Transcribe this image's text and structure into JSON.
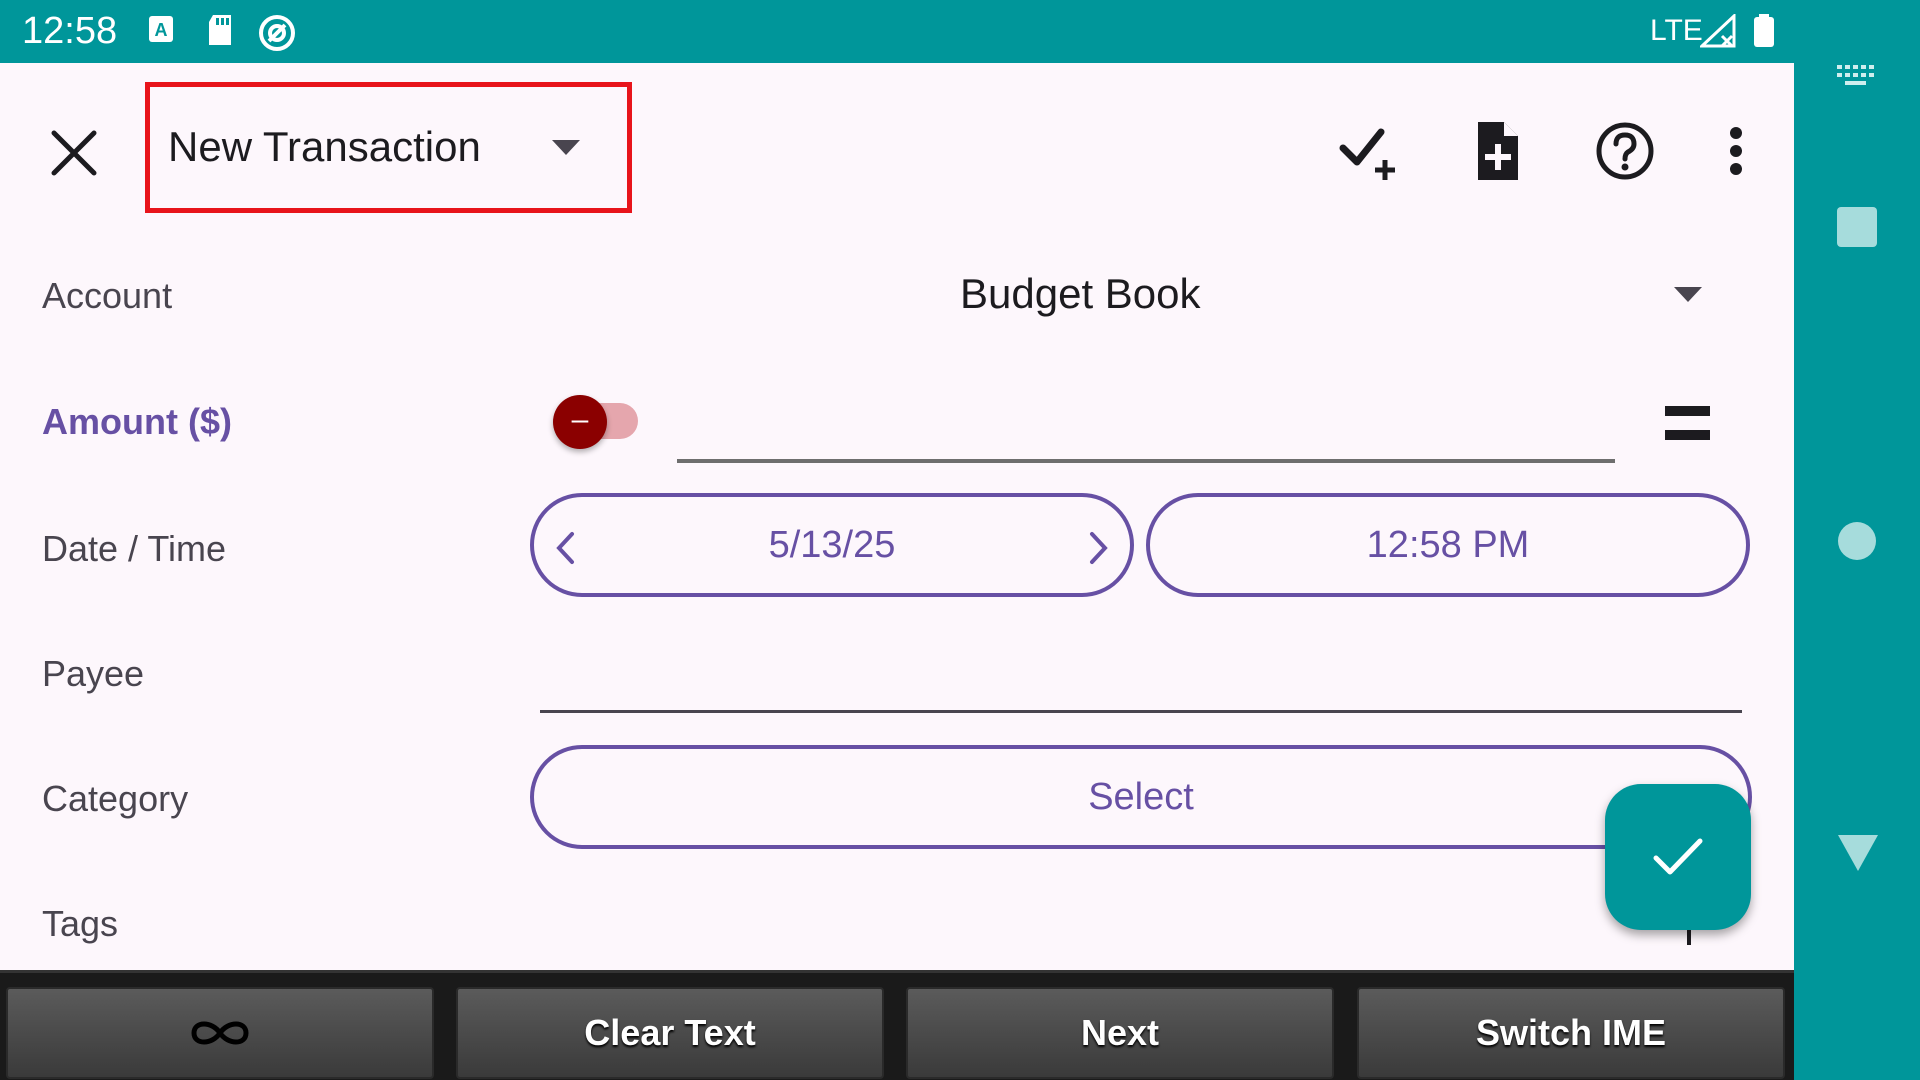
{
  "status_bar": {
    "time": "12:58",
    "network": "LTE",
    "icons": [
      "a-notification-icon",
      "sd-card-icon",
      "sync-icon",
      "signal-icon",
      "battery-icon"
    ]
  },
  "toolbar": {
    "title": "New Transaction",
    "icons": [
      "close-icon",
      "dropdown-caret-icon",
      "save-and-new-icon",
      "add-document-icon",
      "help-icon",
      "more-vert-icon"
    ]
  },
  "form": {
    "account_label": "Account",
    "account_value": "Budget Book",
    "amount_label": "Amount ($)",
    "amount_value": "",
    "amount_sign": "–",
    "datetime_label": "Date / Time",
    "date_value": "5/13/25",
    "time_value": "12:58 PM",
    "payee_label": "Payee",
    "payee_value": "",
    "category_label": "Category",
    "category_button": "Select",
    "tags_label": "Tags"
  },
  "keyboard_bar": {
    "keys": [
      "",
      "Clear Text",
      "Next",
      "Switch IME"
    ],
    "first_key_icon": "infinity-icon"
  },
  "nav_bar": {
    "icons": [
      "keyboard-icon",
      "recents-square-icon",
      "home-circle-icon",
      "back-triangle-icon"
    ]
  },
  "colors": {
    "status_bar": "#00969a",
    "accent": "#6750a4",
    "highlight_box": "#e8141b",
    "switch_thumb": "#8b0000",
    "fab": "#00969a"
  }
}
